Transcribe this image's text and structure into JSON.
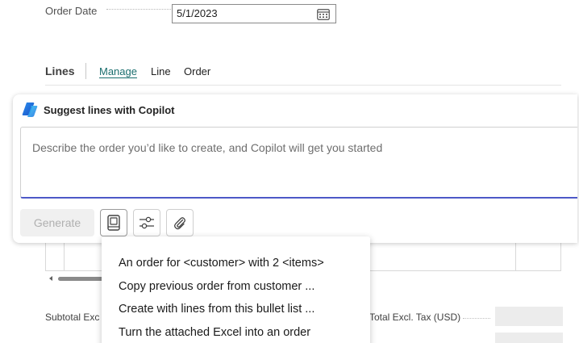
{
  "order_date": {
    "label": "Order Date",
    "value": "5/1/2023"
  },
  "lines": {
    "title": "Lines",
    "tabs": [
      {
        "label": "Manage"
      },
      {
        "label": "Line"
      },
      {
        "label": "Order"
      }
    ]
  },
  "copilot": {
    "title": "Suggest lines with Copilot",
    "placeholder": "Describe the order you’d like to create, and Copilot will get you started",
    "generate_label": "Generate",
    "colors": {
      "accent": "#4d58c7",
      "tab_link": "#1a6e6e"
    }
  },
  "prompt_menu": {
    "items": [
      {
        "label": "An order for <customer> with 2 <items>"
      },
      {
        "label": "Copy previous order from customer ..."
      },
      {
        "label": "Create with lines from this bullet list ..."
      },
      {
        "label": "Turn the attached Excel into an order"
      }
    ]
  },
  "totals": {
    "subtotal_left_label": "Subtotal Exc",
    "subtotal_right_label": "Total Excl. Tax (USD)"
  },
  "icons": {
    "calendar": "calendar-icon",
    "copilot": "copilot-logo-icon",
    "prompts": "prompt-book-icon",
    "settings": "sliders-icon",
    "attach": "paperclip-icon"
  }
}
